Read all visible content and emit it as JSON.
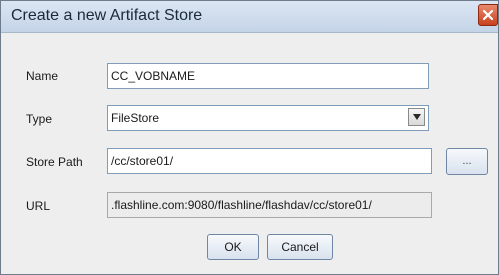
{
  "dialog": {
    "title": "Create a new Artifact Store"
  },
  "form": {
    "name": {
      "label": "Name",
      "value": "CC_VOBNAME"
    },
    "type": {
      "label": "Type",
      "value": "FileStore"
    },
    "store_path": {
      "label": "Store Path",
      "value": "/cc/store01/",
      "browse_label": "..."
    },
    "url": {
      "label": "URL",
      "value": ".flashline.com:9080/flashline/flashdav/cc/store01/"
    }
  },
  "buttons": {
    "ok": "OK",
    "cancel": "Cancel"
  },
  "colors": {
    "titlebar": "#c4d4e7",
    "close": "#c9401f",
    "field_border": "#7f9db9"
  }
}
